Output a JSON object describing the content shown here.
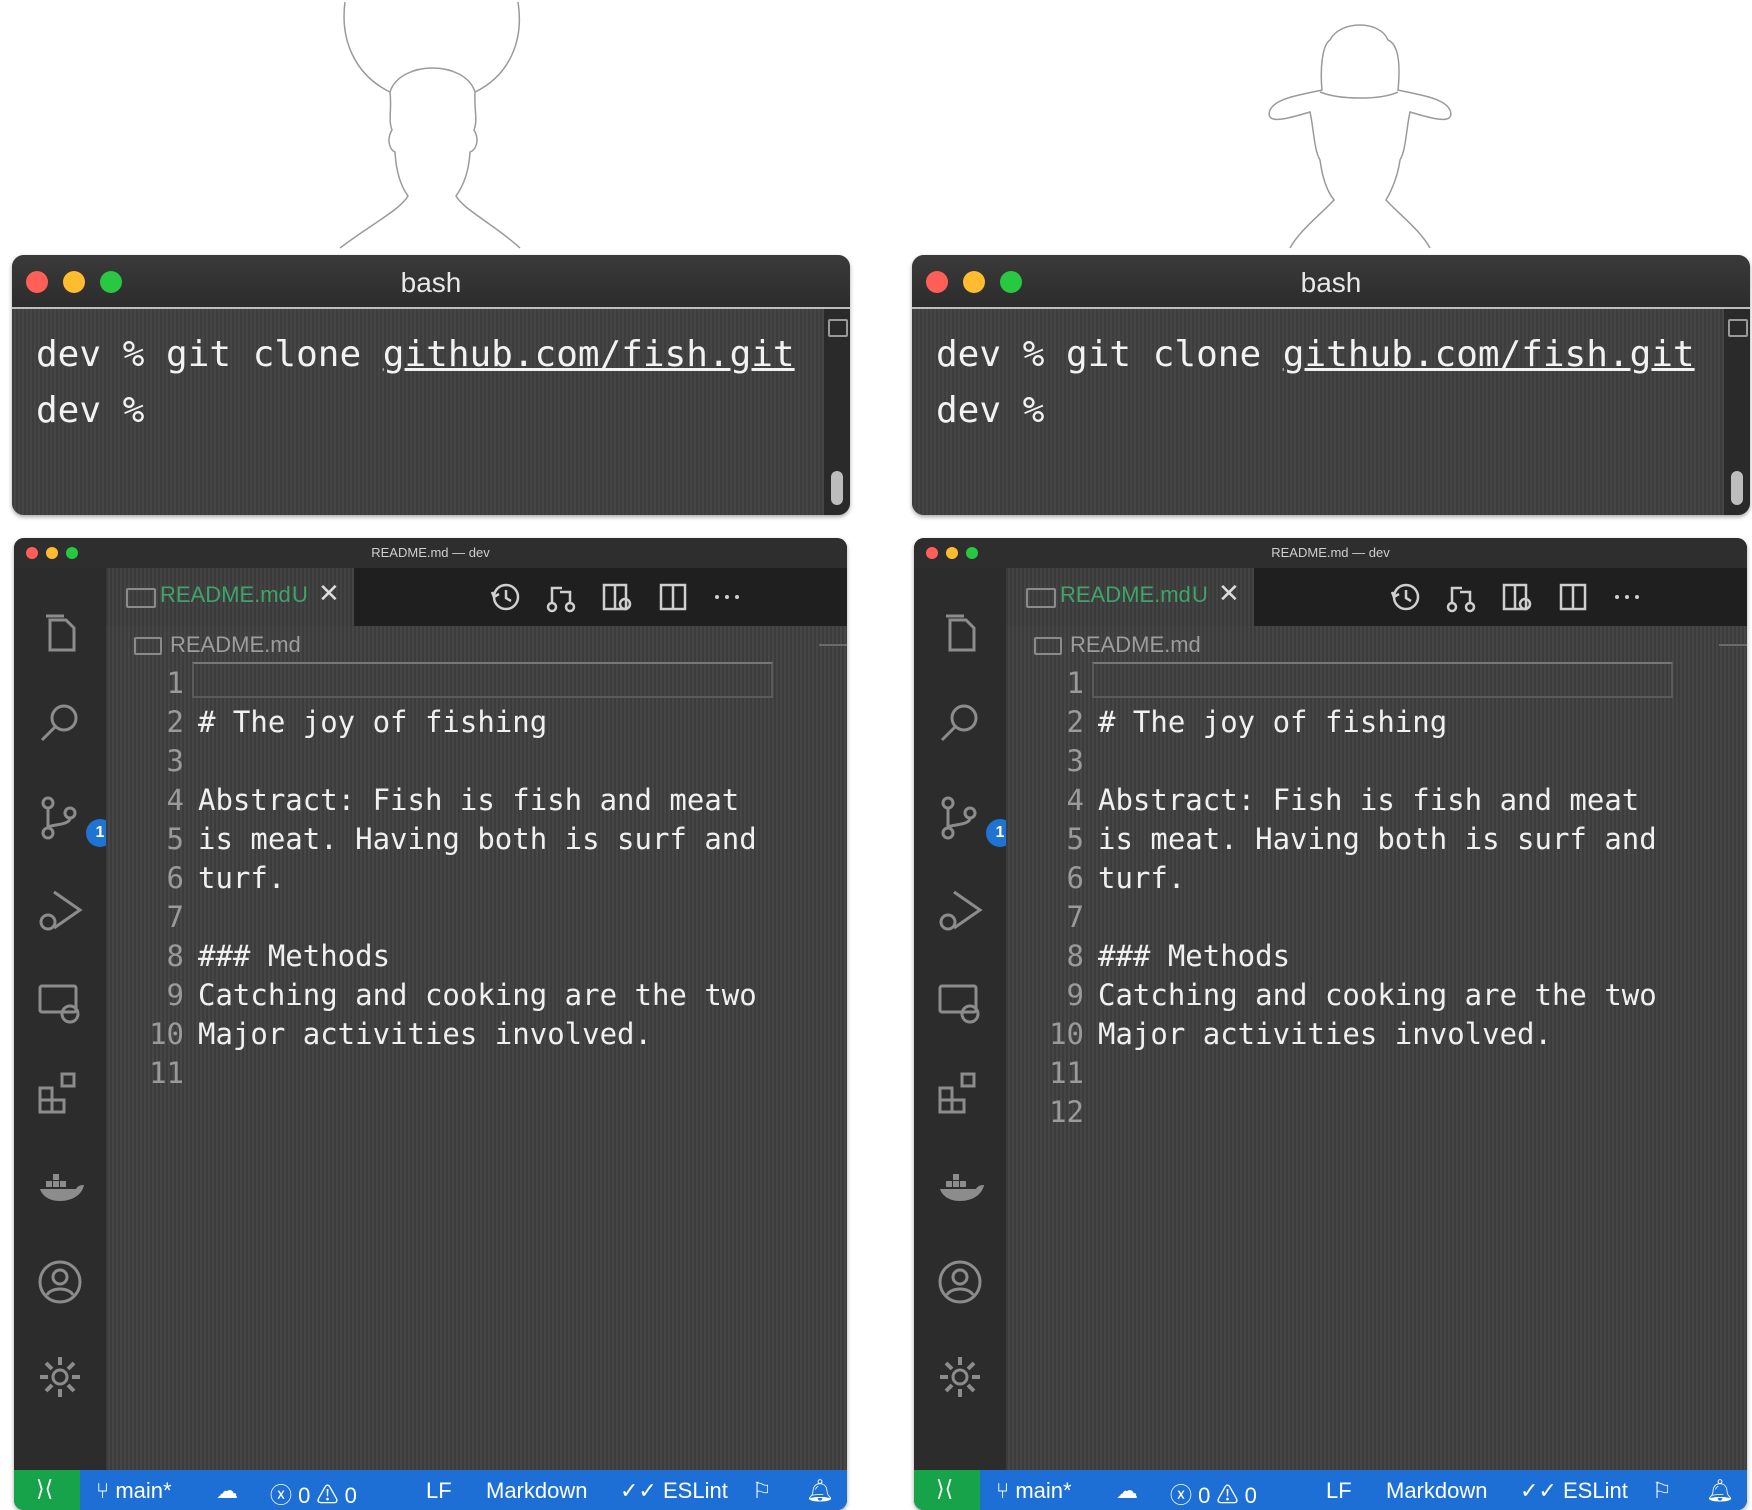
{
  "terminal": {
    "title": "bash",
    "line1_prompt": "dev % ",
    "line1_cmd": "git clone ",
    "line1_url": "github.com/fish.git",
    "line2_prompt": "dev %"
  },
  "vscode": {
    "window_title": "README.md — dev",
    "tab": {
      "filename": "README.md",
      "status": "U",
      "close": "✕"
    },
    "breadcrumb": "README.md",
    "scm_badge": "1",
    "status": {
      "branch": "main*",
      "errors": "0",
      "warnings": "0",
      "eol": "LF",
      "language": "Markdown",
      "linter": "ESLint"
    }
  },
  "left_editor_lines": [
    {
      "n": "1",
      "t": ""
    },
    {
      "n": "2",
      "t": "# The joy of fishing"
    },
    {
      "n": "3",
      "t": ""
    },
    {
      "n": "4",
      "t": "Abstract: Fish is fish and meat"
    },
    {
      "n": "5",
      "t": "is meat. Having both is surf and"
    },
    {
      "n": "6",
      "t": "turf."
    },
    {
      "n": "7",
      "t": ""
    },
    {
      "n": "8",
      "t": "### Methods"
    },
    {
      "n": "9",
      "t": "Catching and cooking are the two"
    },
    {
      "n": "10",
      "t": "Major activities involved."
    },
    {
      "n": "11",
      "t": ""
    }
  ],
  "right_editor_lines": [
    {
      "n": "1",
      "t": ""
    },
    {
      "n": "2",
      "t": "# The joy of fishing"
    },
    {
      "n": "3",
      "t": ""
    },
    {
      "n": "4",
      "t": "Abstract: Fish is fish and meat"
    },
    {
      "n": "5",
      "t": "is meat. Having both is surf and"
    },
    {
      "n": "6",
      "t": "turf."
    },
    {
      "n": "7",
      "t": ""
    },
    {
      "n": "8",
      "t": "### Methods"
    },
    {
      "n": "9",
      "t": "Catching and cooking are the two"
    },
    {
      "n": "10",
      "t": "Major activities involved."
    },
    {
      "n": "11",
      "t": ""
    },
    {
      "n": "12",
      "t": ""
    }
  ],
  "icons": {
    "left_silhouette": "horned-person-silhouette",
    "right_silhouette": "cowboy-hat-person-silhouette"
  },
  "colors": {
    "status_bar": "#1d6fd6",
    "remote_indicator": "#16a34a",
    "modified_tab": "#3fa46a",
    "badge": "#1f74d3"
  }
}
